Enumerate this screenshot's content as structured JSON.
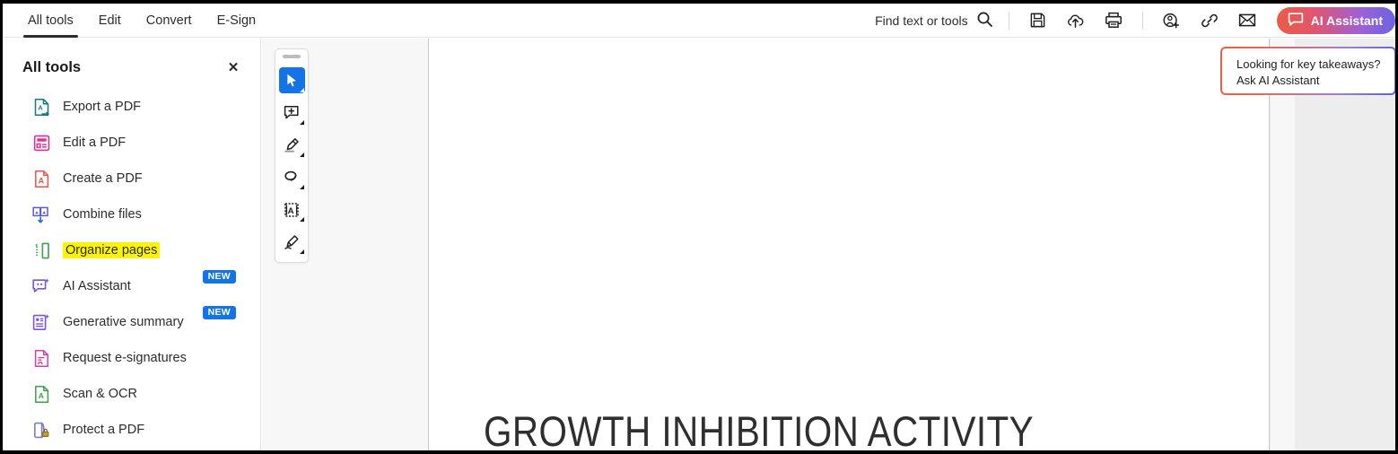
{
  "topbar": {
    "tabs": [
      {
        "label": "All tools",
        "active": true
      },
      {
        "label": "Edit",
        "active": false
      },
      {
        "label": "Convert",
        "active": false
      },
      {
        "label": "E-Sign",
        "active": false
      }
    ],
    "find": {
      "label": "Find text or tools",
      "icon": "search-icon"
    },
    "icons": [
      {
        "name": "save-icon"
      },
      {
        "name": "cloud-upload-icon"
      },
      {
        "name": "print-icon"
      },
      {
        "name": "add-person-icon"
      },
      {
        "name": "link-icon"
      },
      {
        "name": "email-icon"
      }
    ],
    "ai_button": {
      "label": "AI Assistant",
      "icon": "chat-bubble-icon"
    }
  },
  "sidebar": {
    "title": "All tools",
    "close_icon": "close-icon",
    "close_label": "✕",
    "items": [
      {
        "label": "Export a PDF",
        "icon": "export-pdf-icon",
        "badge": "",
        "highlighted": false
      },
      {
        "label": "Edit a PDF",
        "icon": "edit-pdf-icon",
        "badge": "",
        "highlighted": false
      },
      {
        "label": "Create a PDF",
        "icon": "create-pdf-icon",
        "badge": "",
        "highlighted": false
      },
      {
        "label": "Combine files",
        "icon": "combine-files-icon",
        "badge": "",
        "highlighted": false
      },
      {
        "label": "Organize pages",
        "icon": "organize-pages-icon",
        "badge": "",
        "highlighted": true
      },
      {
        "label": "AI Assistant",
        "icon": "ai-assistant-icon",
        "badge": "NEW",
        "highlighted": false
      },
      {
        "label": "Generative summary",
        "icon": "generative-summary-icon",
        "badge": "NEW",
        "highlighted": false
      },
      {
        "label": "Request e-signatures",
        "icon": "request-esign-icon",
        "badge": "",
        "highlighted": false
      },
      {
        "label": "Scan & OCR",
        "icon": "scan-ocr-icon",
        "badge": "",
        "highlighted": false
      },
      {
        "label": "Protect a PDF",
        "icon": "protect-pdf-icon",
        "badge": "",
        "highlighted": false
      }
    ]
  },
  "toolrail": {
    "tools": [
      {
        "name": "select-tool",
        "active": true
      },
      {
        "name": "add-comment-tool",
        "active": false
      },
      {
        "name": "highlight-tool",
        "active": false
      },
      {
        "name": "draw-lasso-tool",
        "active": false
      },
      {
        "name": "select-text-tool",
        "active": false
      },
      {
        "name": "fill-and-sign-tool",
        "active": false
      }
    ]
  },
  "callout": {
    "line1": "Looking for key takeaways?",
    "line2": "Ask AI Assistant"
  },
  "document": {
    "title": "GROWTH INHIBITION ACTIVITY"
  },
  "colors": {
    "accent_blue": "#1473e6",
    "highlight_yellow": "#fcf400",
    "ai_gradient_start": "#eb5c45",
    "ai_gradient_end": "#6c63e0"
  }
}
